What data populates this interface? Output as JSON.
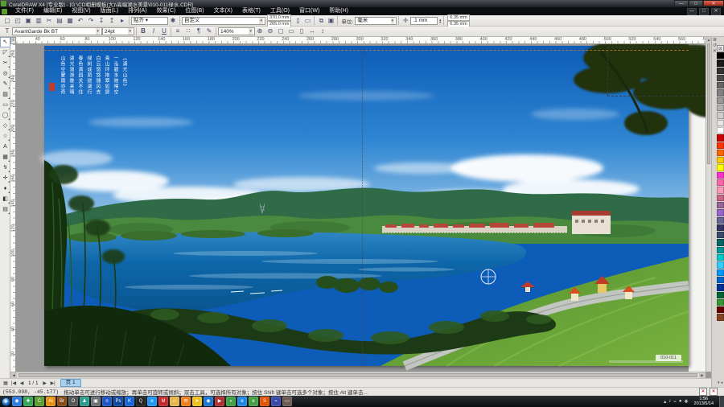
{
  "window": {
    "title": "CorelDRAW X4 [专业版] - [G:\\CD相册模板(大)\\高端湖水美景\\010-011绿水.CDR]",
    "controls": {
      "minimize": "—",
      "maximize": "□",
      "close": "✕"
    },
    "doc_controls": [
      "—",
      "□",
      "✕"
    ]
  },
  "menus": [
    "文件(F)",
    "编辑(E)",
    "视图(V)",
    "版面(L)",
    "排列(A)",
    "效果(C)",
    "位图(B)",
    "文本(X)",
    "表格(T)",
    "工具(O)",
    "窗口(W)",
    "帮助(H)"
  ],
  "toolbar": {
    "icons": [
      {
        "name": "new-icon",
        "glyph": "▢"
      },
      {
        "name": "open-icon",
        "glyph": "◰"
      },
      {
        "name": "save-icon",
        "glyph": "▣"
      },
      {
        "name": "print-icon",
        "glyph": "▥"
      },
      {
        "name": "cut-icon",
        "glyph": "✂"
      },
      {
        "name": "copy-icon",
        "glyph": "▤"
      },
      {
        "name": "paste-icon",
        "glyph": "▦"
      },
      {
        "name": "undo-icon",
        "glyph": "↶"
      },
      {
        "name": "redo-icon",
        "glyph": "↷"
      },
      {
        "name": "import-icon",
        "glyph": "↧"
      },
      {
        "name": "export-icon",
        "glyph": "↥"
      },
      {
        "name": "app-launcher-icon",
        "glyph": "▸"
      }
    ],
    "snap_label": "贴齐 ▾",
    "options_glyph": "✱",
    "page_preset": "自定义",
    "page_width": "370.0 mm",
    "page_height": "265.0 mm",
    "units_label": "单位:",
    "units_value": "毫米",
    "nudge_value": ".1 mm",
    "dup_x": "6.35 mm",
    "dup_y": "6.35 mm"
  },
  "textbar": {
    "font_name": "AvantGarde Bk BT",
    "font_size": "24pt",
    "style_buttons": [
      "B",
      "I",
      "U"
    ],
    "para_icons": [
      {
        "name": "alignment-icon",
        "glyph": "≡"
      },
      {
        "name": "bullet-list-icon",
        "glyph": "∷"
      },
      {
        "name": "drop-cap-icon",
        "glyph": "¶"
      },
      {
        "name": "edit-text-icon",
        "glyph": "✎"
      }
    ],
    "zoom_level": "140%",
    "zoom_icons": [
      {
        "name": "zoom-in-icon",
        "glyph": "⊕"
      },
      {
        "name": "zoom-out-icon",
        "glyph": "⊖"
      },
      {
        "name": "zoom-selected-icon",
        "glyph": "◻"
      },
      {
        "name": "zoom-all-icon",
        "glyph": "▭"
      },
      {
        "name": "zoom-page-icon",
        "glyph": "▯"
      },
      {
        "name": "zoom-width-icon",
        "glyph": "↔"
      },
      {
        "name": "zoom-height-icon",
        "glyph": "↕"
      }
    ]
  },
  "rulers": {
    "h": {
      "start": 20,
      "step": 20,
      "end": 580,
      "px0": 3,
      "pitch": 30.8
    },
    "v": {
      "start": 260,
      "step": -20,
      "end": 20,
      "px0": 9.5,
      "pitch": 31
    }
  },
  "toolbox": [
    {
      "name": "pick-tool",
      "glyph": "↖"
    },
    {
      "name": "shape-tool",
      "glyph": "◸"
    },
    {
      "name": "crop-tool",
      "glyph": "✂"
    },
    {
      "name": "zoom-tool",
      "glyph": "◎"
    },
    {
      "name": "freehand-tool",
      "glyph": "✎"
    },
    {
      "name": "smart-fill-tool",
      "glyph": "▨"
    },
    {
      "name": "rectangle-tool",
      "glyph": "▭"
    },
    {
      "name": "ellipse-tool",
      "glyph": "◯"
    },
    {
      "name": "polygon-tool",
      "glyph": "◇"
    },
    {
      "name": "basic-shapes-tool",
      "glyph": "☆"
    },
    {
      "name": "text-tool",
      "glyph": "A"
    },
    {
      "name": "table-tool",
      "glyph": "▦"
    },
    {
      "name": "blend-tool",
      "glyph": "↯"
    },
    {
      "name": "eyedropper-tool",
      "glyph": "✛"
    },
    {
      "name": "outline-tool",
      "glyph": "♦"
    },
    {
      "name": "fill-tool",
      "glyph": "◧"
    },
    {
      "name": "interactive-fill-tool",
      "glyph": "▤"
    }
  ],
  "palette": {
    "docker_icons": [
      "≣",
      "↺",
      "✕"
    ],
    "none_swatch": "⊠",
    "colors": [
      "#000000",
      "#1a1a1a",
      "#333333",
      "#4d4d4d",
      "#666666",
      "#808080",
      "#999999",
      "#b3b3b3",
      "#cccccc",
      "#e6e6e6",
      "#ffffff",
      "#cc0000",
      "#ff3300",
      "#ff6600",
      "#ffcc00",
      "#ffff00",
      "#ff33cc",
      "#ff66aa",
      "#ff99bb",
      "#cc6688",
      "#996699",
      "#9966cc",
      "#666699",
      "#333366",
      "#3a4a6b",
      "#006666",
      "#009999",
      "#00cccc",
      "#33ccff",
      "#0099ff",
      "#0066cc",
      "#003399",
      "#006633",
      "#339933",
      "#660000",
      "#884422"
    ],
    "scroll_arrows": [
      "▾",
      "◂"
    ]
  },
  "page_nav": {
    "first_glyph": "|◀",
    "prev_glyph": "◀",
    "current": "1 / 1",
    "next_glyph": "▶",
    "last_glyph": "▶|",
    "add_page_glyph": "▦",
    "tab_label": "页 1"
  },
  "status_bar": {
    "coords": "(553.098, -45.177)",
    "hint": "拖动单击可进行移动或缩放；再单击可旋转或倾斜；双击工具，可选择所有对象；按住 Shift 键单击可选多个对象；按住 Alt 键单击..."
  },
  "photo": {
    "poem_columns": [
      "《湖光山色》",
      "一泓碧水映晴空",
      "青山环抱翠如屏",
      "白云悠悠随风去",
      "绿树成荫绕湖行",
      "春色满园关不住",
      "湖光潋滟晚来晴",
      "山色空蒙雨亦奇"
    ],
    "label": "010-011",
    "colors": {
      "sky_top": "#0d5cb8",
      "sky_bottom": "#aacfec",
      "lake": "#0d66a8",
      "hill": "#6aa33c",
      "mountain": "#3a7a4a",
      "branch": "#20300e",
      "seal_red": "#c23a28"
    }
  },
  "taskbar": {
    "start_glyph": "❖",
    "apps": [
      {
        "name": "taskbar-app-browser-globe",
        "glyph": "◉",
        "bg": "#2a7de0"
      },
      {
        "name": "taskbar-app-360safe",
        "glyph": "✚",
        "bg": "#34a853"
      },
      {
        "name": "taskbar-app-coreldraw",
        "glyph": "C",
        "bg": "#5a9e2f"
      },
      {
        "name": "taskbar-app-illustrator",
        "glyph": "Ai",
        "bg": "#e8920c"
      },
      {
        "name": "taskbar-app-bridge",
        "glyph": "Br",
        "bg": "#8a4a12"
      },
      {
        "name": "taskbar-app-office",
        "glyph": "O",
        "bg": "#555555"
      },
      {
        "name": "taskbar-app-qq-game",
        "glyph": "♟",
        "bg": "#2a9d8f"
      },
      {
        "name": "taskbar-app-image-viewer",
        "glyph": "▣",
        "bg": "#6a7076"
      },
      {
        "name": "taskbar-app-n",
        "glyph": "n",
        "bg": "#1c56c8"
      },
      {
        "name": "taskbar-app-photoshop",
        "glyph": "Ps",
        "bg": "#0d47a1"
      },
      {
        "name": "taskbar-app-kugou",
        "glyph": "K",
        "bg": "#1565d8"
      },
      {
        "name": "taskbar-app-qq",
        "glyph": "Q",
        "bg": "#222222"
      },
      {
        "name": "taskbar-app-360browser",
        "glyph": "e",
        "bg": "#2196f3"
      },
      {
        "name": "taskbar-app-m-red",
        "glyph": "M",
        "bg": "#c62828"
      },
      {
        "name": "taskbar-app-folder",
        "glyph": "▱",
        "bg": "#e8b64a"
      },
      {
        "name": "taskbar-app-foxmail",
        "glyph": "✉",
        "bg": "#ef7f1a"
      },
      {
        "name": "taskbar-app-thunder",
        "glyph": "➤",
        "bg": "#f0c020"
      },
      {
        "name": "taskbar-app-maxthon",
        "glyph": "◉",
        "bg": "#1976d2"
      },
      {
        "name": "taskbar-app-player",
        "glyph": "▶",
        "bg": "#b03030"
      },
      {
        "name": "taskbar-app-green-bird",
        "glyph": "◗",
        "bg": "#43a047"
      },
      {
        "name": "taskbar-app-ie",
        "glyph": "e",
        "bg": "#1e88e5"
      },
      {
        "name": "taskbar-app-e-green",
        "glyph": "e",
        "bg": "#43a047"
      },
      {
        "name": "taskbar-app-sogou",
        "glyph": "S",
        "bg": "#e65100"
      },
      {
        "name": "taskbar-app-device",
        "glyph": "⌁",
        "bg": "#3949ab"
      },
      {
        "name": "taskbar-app-drive",
        "glyph": "▭",
        "bg": "#6d5b53"
      }
    ],
    "tray_icons": [
      "▴",
      "♪",
      "⌁",
      "●",
      "✚"
    ],
    "clock_time": "1:56",
    "clock_date": "2013/5/14"
  }
}
